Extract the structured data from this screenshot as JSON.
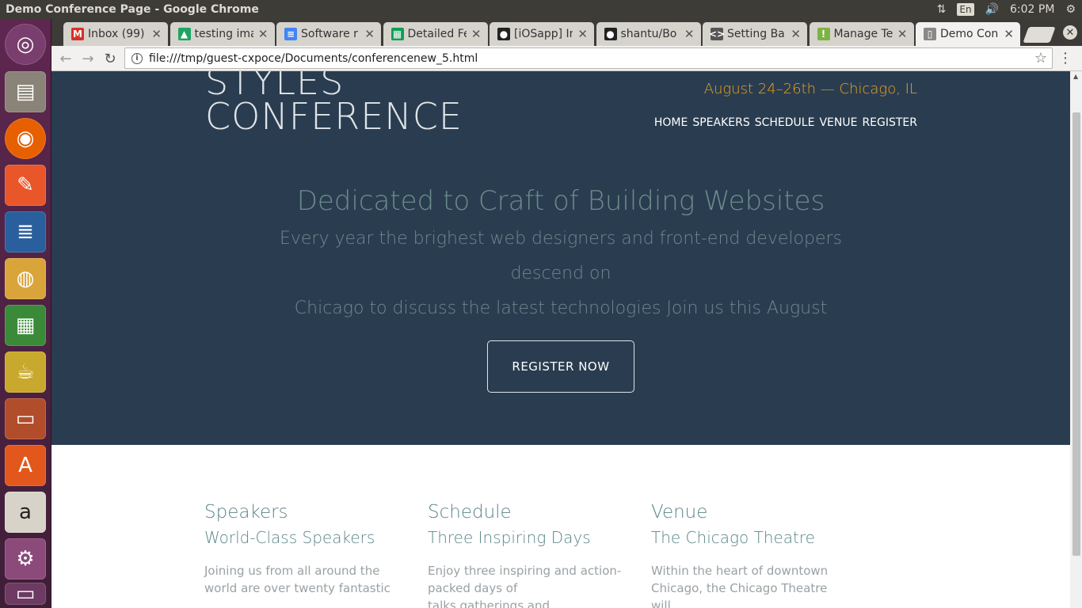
{
  "window": {
    "title": "Demo Conference Page - Google Chrome",
    "lang": "En",
    "time": "6:02 PM"
  },
  "tabs": [
    {
      "label": "Inbox (99)",
      "icon": "gmail-icon",
      "color": "#d93025",
      "glyph": "M"
    },
    {
      "label": "testing ima",
      "icon": "google-drive-icon",
      "color": "#1fa463",
      "glyph": "▲"
    },
    {
      "label": "Software r",
      "icon": "google-docs-icon",
      "color": "#4285f4",
      "glyph": "≡"
    },
    {
      "label": "Detailed Fe",
      "icon": "google-sheets-icon",
      "color": "#0f9d58",
      "glyph": "▦"
    },
    {
      "label": "[iOSapp] In",
      "icon": "github-icon",
      "color": "#222222",
      "glyph": "●"
    },
    {
      "label": "shantu/Bo",
      "icon": "github-icon",
      "color": "#222222",
      "glyph": "●"
    },
    {
      "label": "Setting Ba",
      "icon": "code-icon",
      "color": "#555555",
      "glyph": "<>"
    },
    {
      "label": "Manage Te",
      "icon": "manage-icon",
      "color": "#7cb342",
      "glyph": "!"
    },
    {
      "label": "Demo Con",
      "icon": "page-icon",
      "color": "#888888",
      "glyph": "▯"
    }
  ],
  "address": {
    "url": "file:///tmp/guest-cxpoce/Documents/conferencenew_5.html"
  },
  "page": {
    "logo_line1": "STYLES",
    "logo_line2": "CONFERENCE",
    "dates": "August 24–26th — Chicago, IL",
    "nav": [
      "HOME",
      "SPEAKERS",
      "SCHEDULE",
      "VENUE",
      "REGISTER"
    ],
    "headline": "Dedicated to Craft of Building Websites",
    "subline1": "Every year the brighest web designers and front-end developers descend on",
    "subline2": "Chicago to discuss the latest technologies Join us this August",
    "register_label": "REGISTER NOW",
    "columns": [
      {
        "title": "Speakers",
        "subtitle": "World-Class Speakers",
        "text": "Joining us from all around the world are over twenty fantastic"
      },
      {
        "title": "Schedule",
        "subtitle": "Three Inspiring Days",
        "text": "Enjoy three inspiring and action-packed days of talks,gatherings,and"
      },
      {
        "title": "Venue",
        "subtitle": "The Chicago Theatre",
        "text": "Within the heart of downtown Chicago, the Chicago Theatre will"
      }
    ]
  },
  "colors": {
    "hero_bg": "#2a3d50",
    "accent": "#f0a21c",
    "heading": "#5b8587"
  }
}
